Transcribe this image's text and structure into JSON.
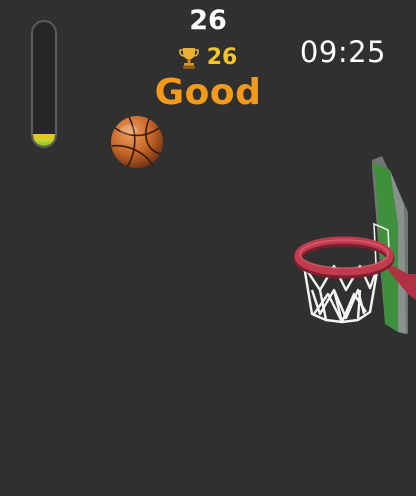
{
  "hud": {
    "score": "26",
    "best_score": "26",
    "rating": "Good",
    "timer": "09:25",
    "power_level": 0.1
  },
  "icons": {
    "best": "trophy-icon",
    "ball": "basketball-icon",
    "hoop": "basketball-hoop"
  },
  "colors": {
    "background": "#303030",
    "score_text": "#ffffff",
    "best_score_text": "#f4c52b",
    "rating_text": "#f39a1c",
    "backboard": "#3f8f3c",
    "rim": "#c23a4e"
  }
}
